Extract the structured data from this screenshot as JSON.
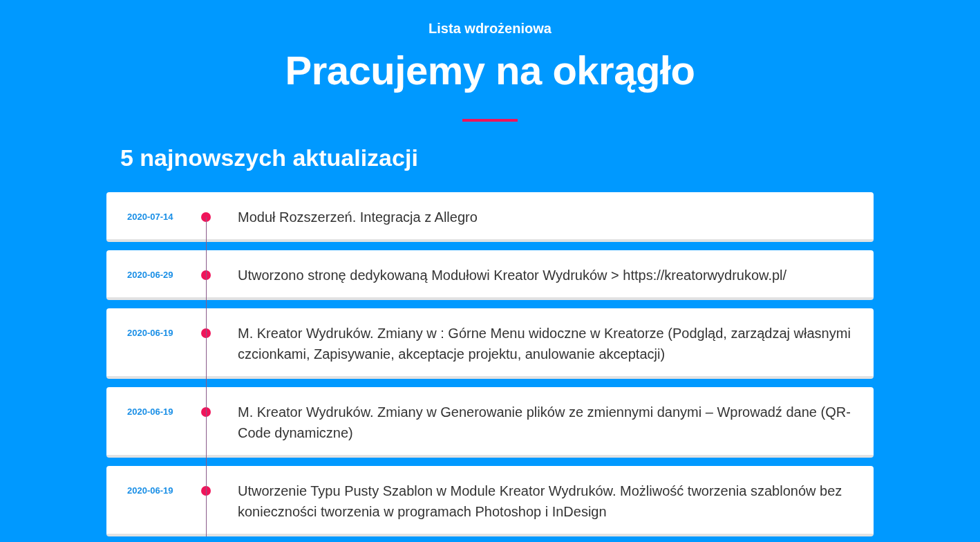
{
  "header": {
    "eyebrow": "Lista wdrożeniowa",
    "title": "Pracujemy na okrągło"
  },
  "updates": {
    "heading": "5 najnowszych aktualizacji",
    "items": [
      {
        "date": "2020-07-14",
        "text": "Moduł Rozszerzeń. Integracja z Allegro"
      },
      {
        "date": "2020-06-29",
        "text": "Utworzono stronę dedykowaną Modułowi Kreator Wydruków > https://kreatorwydrukow.pl/"
      },
      {
        "date": "2020-06-19",
        "text": "M. Kreator Wydruków. Zmiany w : Górne Menu widoczne w Kreatorze (Podgląd, zarządzaj własnymi czcionkami, Zapisywanie, akceptacje projektu, anulowanie akceptacji)"
      },
      {
        "date": "2020-06-19",
        "text": "M. Kreator Wydruków. Zmiany w Generowanie plików ze zmiennymi danymi – Wprowadź dane (QR-Code dynamiczne)"
      },
      {
        "date": "2020-06-19",
        "text": "Utworzenie Typu Pusty Szablon w Module Kreator Wydruków. Możliwość tworzenia szablonów bez konieczności tworzenia w programach Photoshop i InDesign"
      }
    ]
  }
}
